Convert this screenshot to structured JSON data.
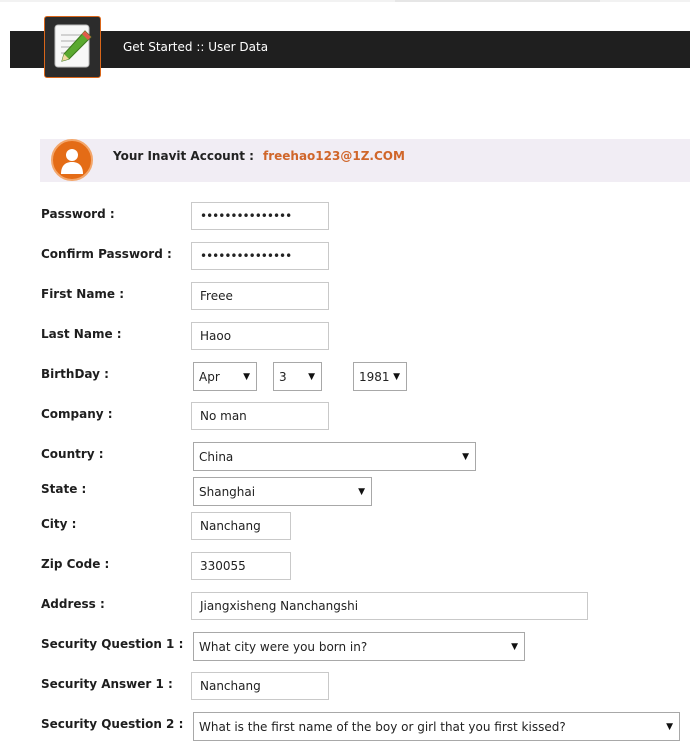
{
  "header": {
    "title": "Get Started :: User Data"
  },
  "account": {
    "label": "Your Inavit Account :",
    "email": "freehao123@1Z.COM"
  },
  "form": {
    "password": {
      "label": "Password :",
      "value": "•••••••••••••••"
    },
    "confirm_password": {
      "label": "Confirm Password :",
      "value": "•••••••••••••••"
    },
    "first_name": {
      "label": "First Name :",
      "value": "Freee"
    },
    "last_name": {
      "label": "Last Name :",
      "value": "Haoo"
    },
    "birthday": {
      "label": "BirthDay :",
      "month": "Apr",
      "day": "3",
      "year": "1981"
    },
    "company": {
      "label": "Company :",
      "value": "No man"
    },
    "country": {
      "label": "Country :",
      "value": "China"
    },
    "state": {
      "label": "State :",
      "value": "Shanghai"
    },
    "city": {
      "label": "City :",
      "value": "Nanchang"
    },
    "zip": {
      "label": "Zip Code :",
      "value": "330055"
    },
    "address": {
      "label": "Address :",
      "value": "Jiangxisheng Nanchangshi"
    },
    "security_q1": {
      "label": "Security Question 1 :",
      "value": "What city were you born in?"
    },
    "security_a1": {
      "label": "Security Answer 1 :",
      "value": "Nanchang"
    },
    "security_q2": {
      "label": "Security Question 2 :",
      "value": "What is the first name of the boy or girl that you first kissed?"
    }
  },
  "colors": {
    "header_bg": "#1f1f1f",
    "accent": "#e46c16",
    "account_bar_bg": "#f1edf4",
    "email": "#d0662a"
  },
  "icons": {
    "app": "notepad-pencil-icon",
    "avatar": "user-avatar-icon",
    "dropdown": "caret-down-icon"
  }
}
